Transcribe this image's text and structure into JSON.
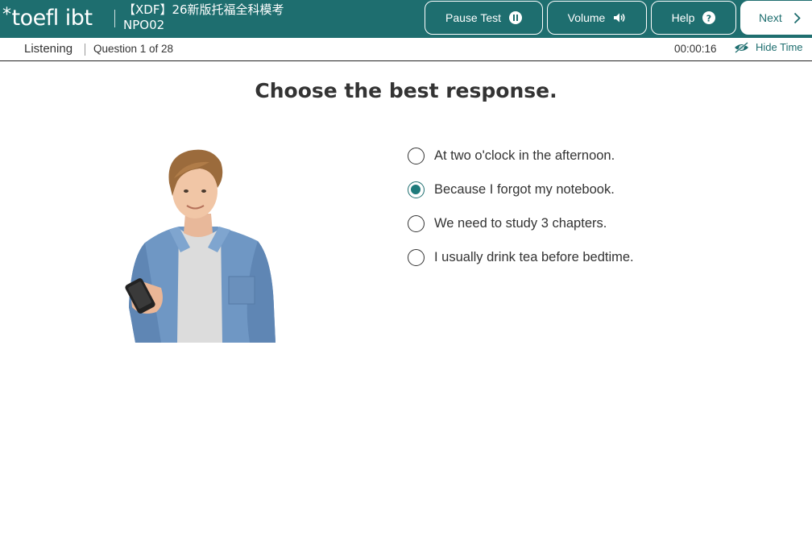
{
  "header": {
    "logo_star": "*",
    "logo_text": "toefl ibt",
    "test_name_line1": "【XDF】26新版托福全科模考",
    "test_name_line2": "NPO02",
    "pause_label": "Pause Test",
    "volume_label": "Volume",
    "help_label": "Help",
    "next_label": "Next"
  },
  "subbar": {
    "section": "Listening",
    "question_counter": "Question 1 of 28",
    "timer": "00:00:16",
    "hide_time_label": "Hide Time"
  },
  "main": {
    "instruction": "Choose the best response.",
    "options": [
      {
        "label": "At two o'clock in the afternoon.",
        "selected": false
      },
      {
        "label": "Because I forgot my notebook.",
        "selected": true
      },
      {
        "label": "We need to study 3 chapters.",
        "selected": false
      },
      {
        "label": "I usually drink tea before bedtime.",
        "selected": false
      }
    ]
  },
  "colors": {
    "brand_teal": "#1e6e6f",
    "text": "#333333"
  },
  "icons": {
    "pause": "pause-circle-icon",
    "volume": "speaker-icon",
    "help": "question-circle-icon",
    "next": "chevron-right-icon",
    "hide_time": "eye-slash-icon"
  }
}
